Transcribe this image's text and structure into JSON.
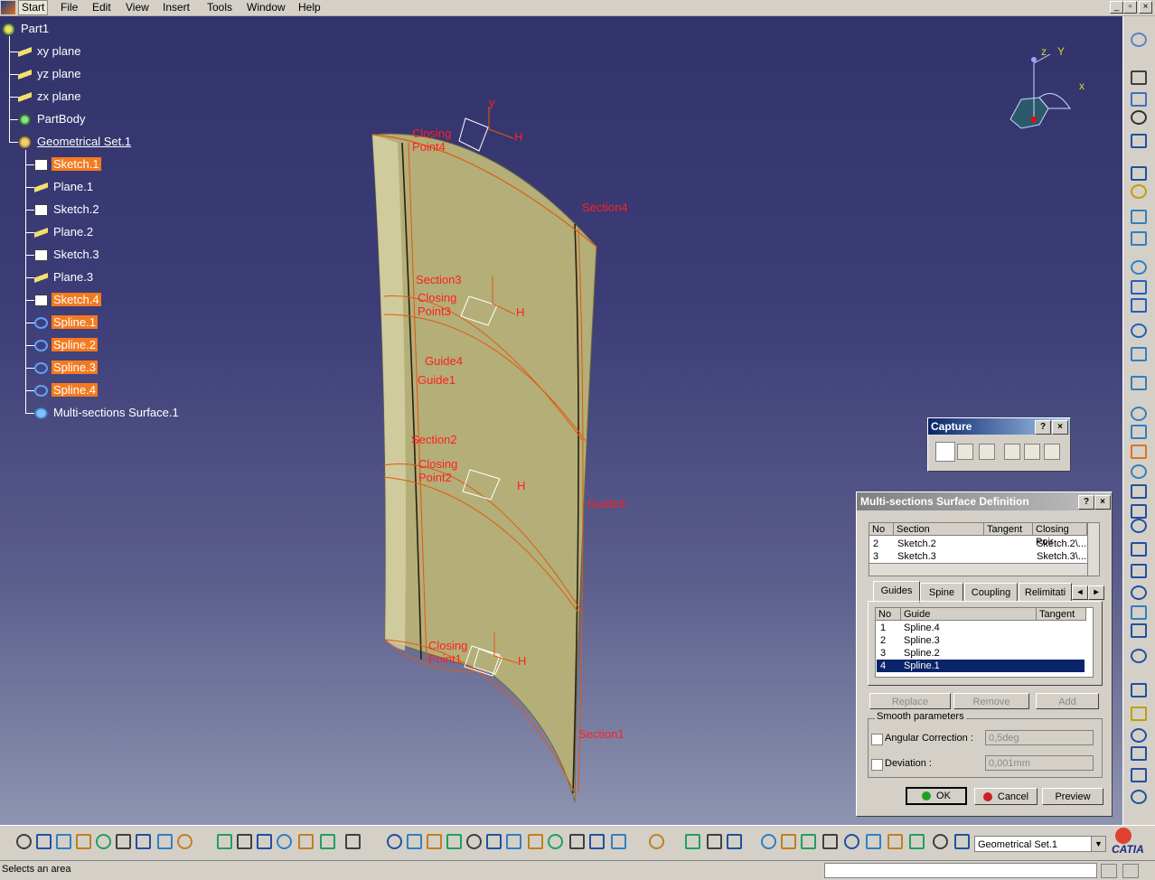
{
  "menu": [
    "Start",
    "File",
    "Edit",
    "View",
    "Insert",
    "Tools",
    "Window",
    "Help"
  ],
  "window_buttons": [
    "_",
    "▫",
    "×"
  ],
  "tree": {
    "root": "Part1",
    "items": [
      {
        "label": "xy plane",
        "selected": false,
        "icon": "plane-icon"
      },
      {
        "label": "yz plane",
        "selected": false,
        "icon": "plane-icon"
      },
      {
        "label": "zx plane",
        "selected": false,
        "icon": "plane-icon"
      },
      {
        "label": "PartBody",
        "selected": false,
        "icon": "body-icon"
      },
      {
        "label": "Geometrical Set.1",
        "selected": false,
        "icon": "geometrical-set-icon"
      },
      {
        "label": "Sketch.1",
        "selected": true,
        "icon": "sketch-icon"
      },
      {
        "label": "Plane.1",
        "selected": false,
        "icon": "plane-icon"
      },
      {
        "label": "Sketch.2",
        "selected": false,
        "icon": "sketch-icon"
      },
      {
        "label": "Plane.2",
        "selected": false,
        "icon": "plane-icon"
      },
      {
        "label": "Sketch.3",
        "selected": false,
        "icon": "sketch-icon"
      },
      {
        "label": "Plane.3",
        "selected": false,
        "icon": "plane-icon"
      },
      {
        "label": "Sketch.4",
        "selected": true,
        "icon": "sketch-icon"
      },
      {
        "label": "Spline.1",
        "selected": true,
        "icon": "spline-icon"
      },
      {
        "label": "Spline.2",
        "selected": true,
        "icon": "spline-icon"
      },
      {
        "label": "Spline.3",
        "selected": true,
        "icon": "spline-icon"
      },
      {
        "label": "Spline.4",
        "selected": true,
        "icon": "spline-icon"
      },
      {
        "label": "Multi-sections Surface.1",
        "selected": false,
        "icon": "multi-section-surface-icon"
      }
    ]
  },
  "scene_labels": {
    "closing_point4": "Closing Point4",
    "section4": "Section4",
    "section3": "Section3",
    "closing_point3": "Closing Point3",
    "guide4": "Guide4",
    "guide1": "Guide1",
    "section2": "Section2",
    "closing_point2": "Closing Point2",
    "closing_point1": "Closing Point1",
    "section1": "Section1",
    "guide_overlap": "Guide3",
    "axis_y": "y",
    "axis_h": "H",
    "compass_z": "z",
    "compass_y": "Y",
    "compass_x": "x"
  },
  "capture": {
    "title": "Capture",
    "help": "?",
    "close": "×"
  },
  "dialog": {
    "title": "Multi-sections Surface Definition",
    "help": "?",
    "close": "×",
    "sections_headers": [
      "No",
      "Section",
      "Tangent",
      "Closing Poir"
    ],
    "sections_rows": [
      {
        "no": "2",
        "section": "Sketch.2",
        "tangent": "",
        "closing": "Sketch.2\\..."
      },
      {
        "no": "3",
        "section": "Sketch.3",
        "tangent": "",
        "closing": "Sketch.3\\..."
      }
    ],
    "tabs": [
      "Guides",
      "Spine",
      "Coupling",
      "Relimitati"
    ],
    "guide_headers": [
      "No",
      "Guide",
      "Tangent"
    ],
    "guide_rows": [
      {
        "no": "1",
        "guide": "Spline.4",
        "selected": false
      },
      {
        "no": "2",
        "guide": "Spline.3",
        "selected": false
      },
      {
        "no": "3",
        "guide": "Spline.2",
        "selected": false
      },
      {
        "no": "4",
        "guide": "Spline.1",
        "selected": true
      }
    ],
    "replace": "Replace",
    "remove": "Remove",
    "add": "Add",
    "smooth_group": "Smooth parameters",
    "angular_label": "Angular Correction :",
    "angular_value": "0,5deg",
    "deviation_label": "Deviation :",
    "deviation_value": "0,001mm",
    "ok": "OK",
    "cancel": "Cancel",
    "preview": "Preview"
  },
  "geom_set_value": "Geometrical Set.1",
  "status_text": "Selects an area",
  "brand": "CATIA",
  "colors": {
    "selection": "#f47a20",
    "surface": "#b8b27a",
    "curve": "#e05a10",
    "label": "#ff2020"
  }
}
